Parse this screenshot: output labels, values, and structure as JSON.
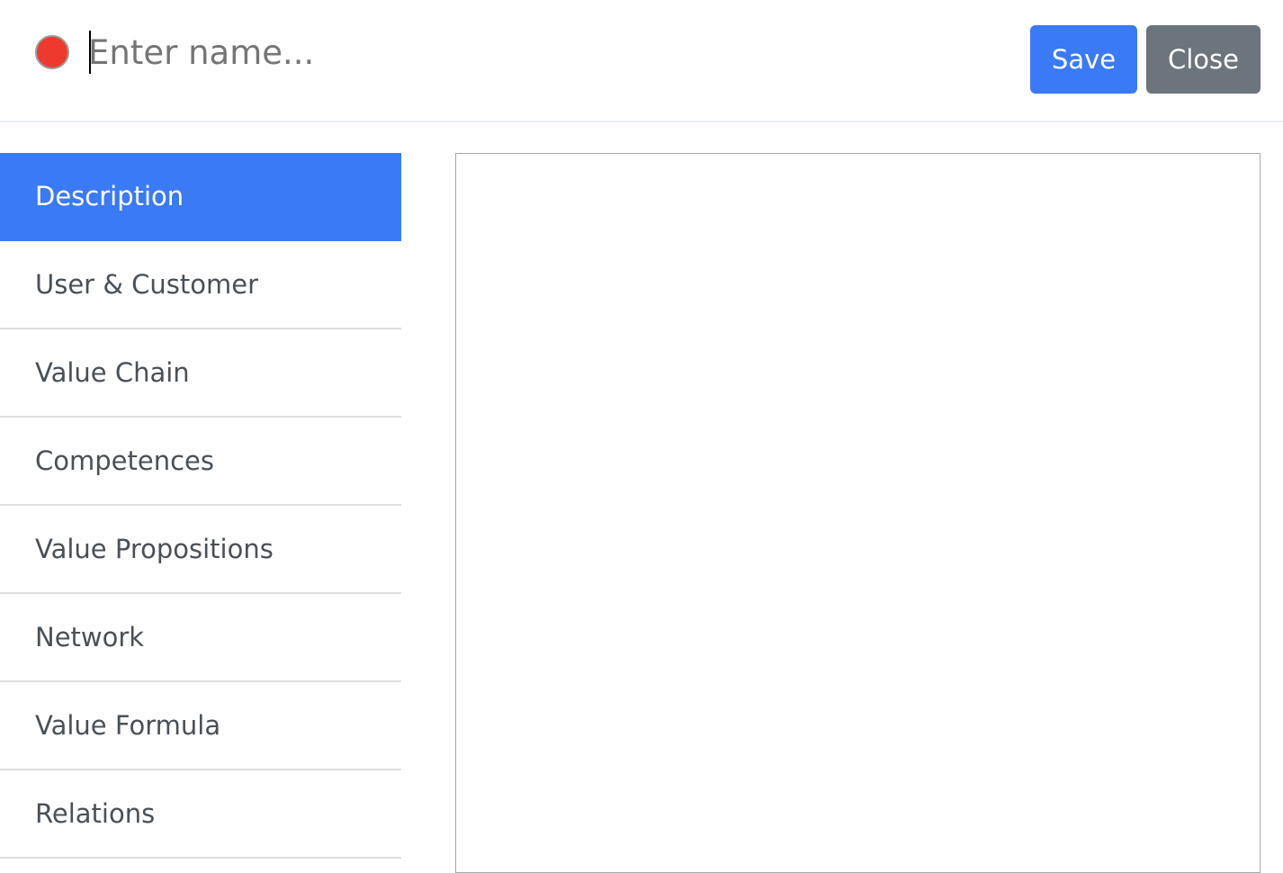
{
  "header": {
    "status_color": "#ee3a2e",
    "name_input": {
      "value": "",
      "placeholder": "Enter name..."
    },
    "save_label": "Save",
    "close_label": "Close"
  },
  "sidebar": {
    "active_index": 0,
    "items": [
      {
        "label": "Description"
      },
      {
        "label": "User & Customer"
      },
      {
        "label": "Value Chain"
      },
      {
        "label": "Competences"
      },
      {
        "label": "Value Propositions"
      },
      {
        "label": "Network"
      },
      {
        "label": "Value Formula"
      },
      {
        "label": "Relations"
      }
    ]
  },
  "colors": {
    "accent": "#3b7af5",
    "secondary": "#6c757d"
  }
}
